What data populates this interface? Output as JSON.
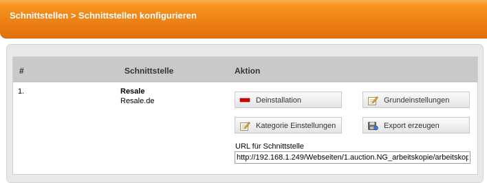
{
  "header": {
    "title": "Schnittstellen > Schnittstellen konfigurieren"
  },
  "table": {
    "columns": [
      "#",
      "Schnittstelle",
      "Aktion"
    ],
    "rows": [
      {
        "number": "1.",
        "name": "Resale",
        "subtitle": "Resale.de",
        "actions": {
          "uninstall": "Deinstallation",
          "base_settings": "Grundeinstellungen",
          "category_settings": "Kategorie Einstellungen",
          "export": "Export erzeugen"
        },
        "url_label": "URL für Schnittstelle",
        "url_value": "http://192.168.1.249/Webseiten/1.auction.NG_arbeitskopie/arbeitskop"
      }
    ]
  },
  "icons": {
    "uninstall": "minus-red-icon",
    "base_settings": "edit-notepad-icon",
    "category_settings": "edit-notepad-icon",
    "export": "disk-export-icon"
  },
  "colors": {
    "header_orange": "#f7931e",
    "uninstall_red": "#d40000"
  }
}
